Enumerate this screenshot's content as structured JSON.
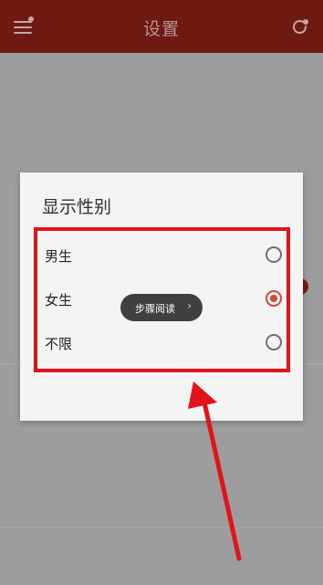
{
  "header": {
    "title": "设置"
  },
  "dialog": {
    "title": "显示性别",
    "options": [
      {
        "label": "男生",
        "selected": false
      },
      {
        "label": "女生",
        "selected": true
      },
      {
        "label": "不限",
        "selected": false
      }
    ]
  },
  "step_reading": {
    "label": "步骤阅读",
    "chevron": "›"
  },
  "colors": {
    "header_bg": "#6e1a12",
    "accent": "#d8473a",
    "highlight_box": "#e0141a"
  },
  "icons": {
    "menu": "menu-icon",
    "refresh": "refresh-icon",
    "radio": "radio-button",
    "arrow": "annotation-arrow"
  }
}
